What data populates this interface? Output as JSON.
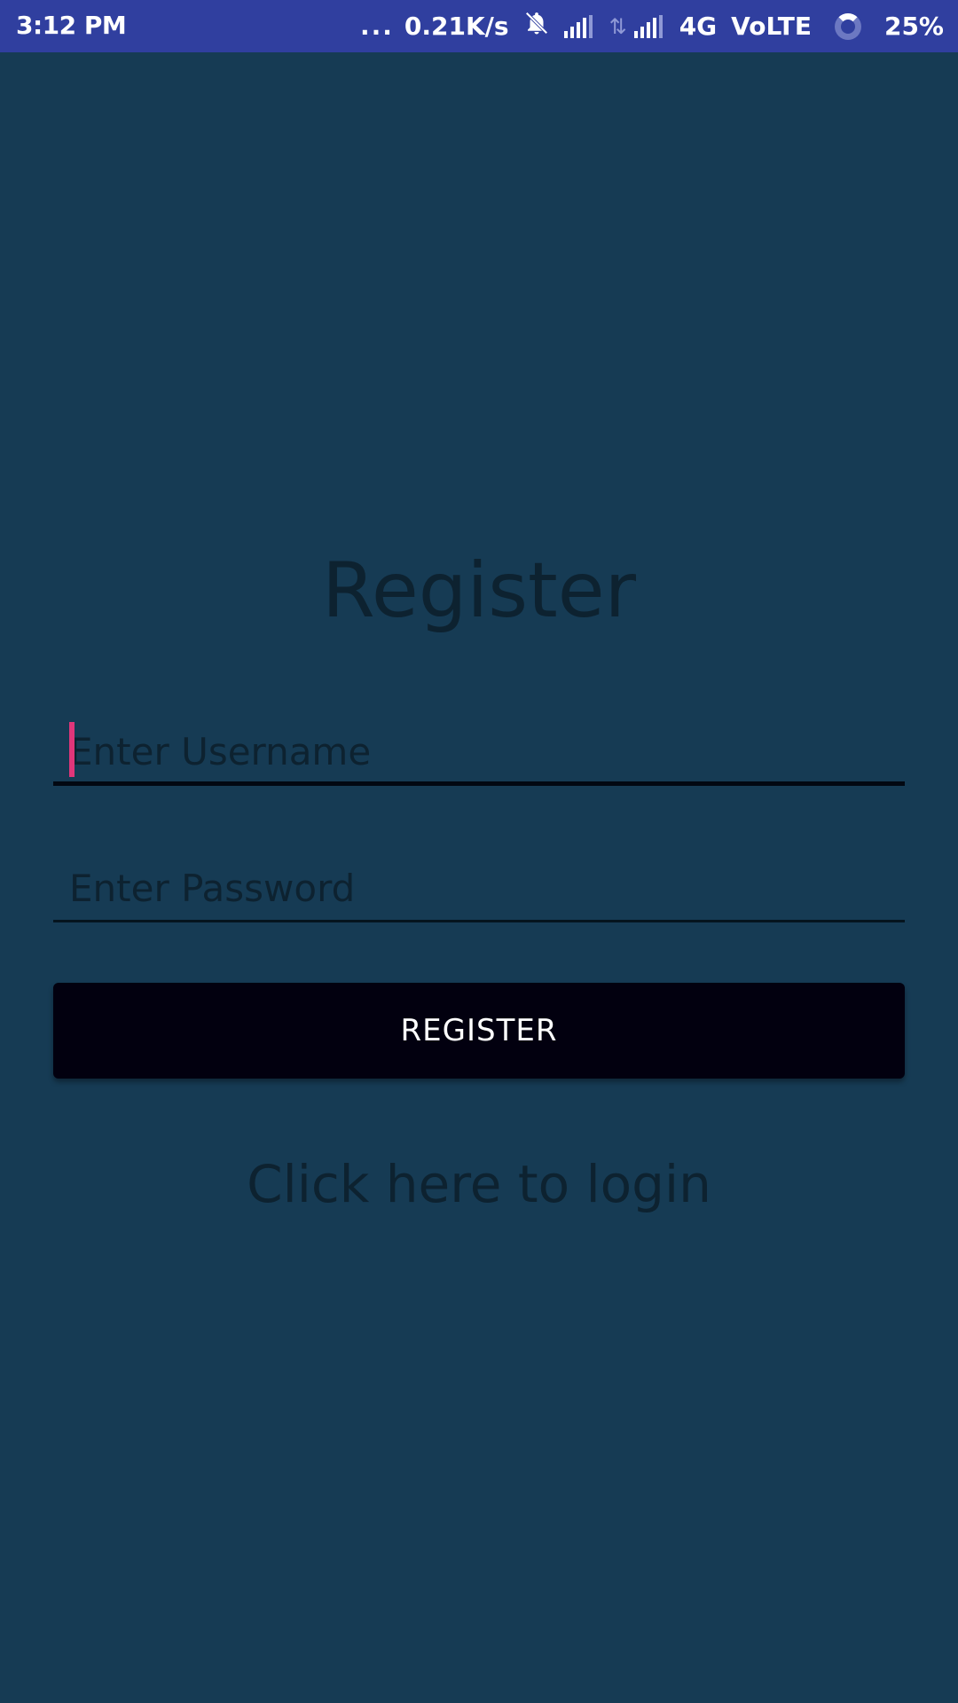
{
  "status_bar": {
    "time": "3:12 PM",
    "overflow": "...",
    "network_speed": "0.21K/s",
    "network_type": "4G",
    "volte": "VoLTE",
    "battery": "25%",
    "icons": [
      "bell-off-icon",
      "signal-icon",
      "data-arrows-icon",
      "signal-icon",
      "battery-ring-icon"
    ]
  },
  "screen": {
    "title": "Register",
    "username_placeholder": "Enter Username",
    "password_placeholder": "Enter Password",
    "register_label": "REGISTER",
    "login_link": "Click here to login"
  },
  "colors": {
    "background": "#163b54",
    "status_bar": "#303f9f",
    "button": "#02000f",
    "caret": "#e0367a",
    "text": "#0d2230"
  }
}
